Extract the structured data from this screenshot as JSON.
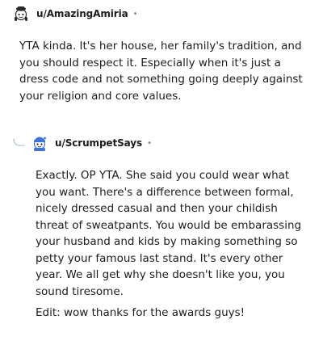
{
  "comments": [
    {
      "username": "u/AmazingAmiria",
      "separator": "•",
      "avatar_icon": "snoo-avatar-icon",
      "paragraphs": [
        "YTA kinda. It's her house, her family's tradition, and you should respect it. Especially when it's just a dress code and not something going deeply against your religion and core values."
      ]
    },
    {
      "username": "u/ScrumpetSays",
      "separator": "•",
      "avatar_icon": "snoo-avatar-icon",
      "reply_indicator_icon": "reply-thread-icon",
      "paragraphs": [
        "Exactly. OP YTA. She said you could wear what you want. There's a difference between formal, nicely dressed casual and then your childish threat of sweatpants. You would be embarassing your husband and kids by making something so petty your famous last stand. It's every other year. We all get why she doesn't like you, you sound tiresome.",
        "Edit: wow thanks for the awards guys!"
      ]
    }
  ],
  "colors": {
    "text": "#1c1c1c",
    "meta": "#7c7c7c",
    "thread_line": "#c8d0d8",
    "avatar_blue": "#3f74d6",
    "avatar_dark": "#2b2b2b"
  }
}
